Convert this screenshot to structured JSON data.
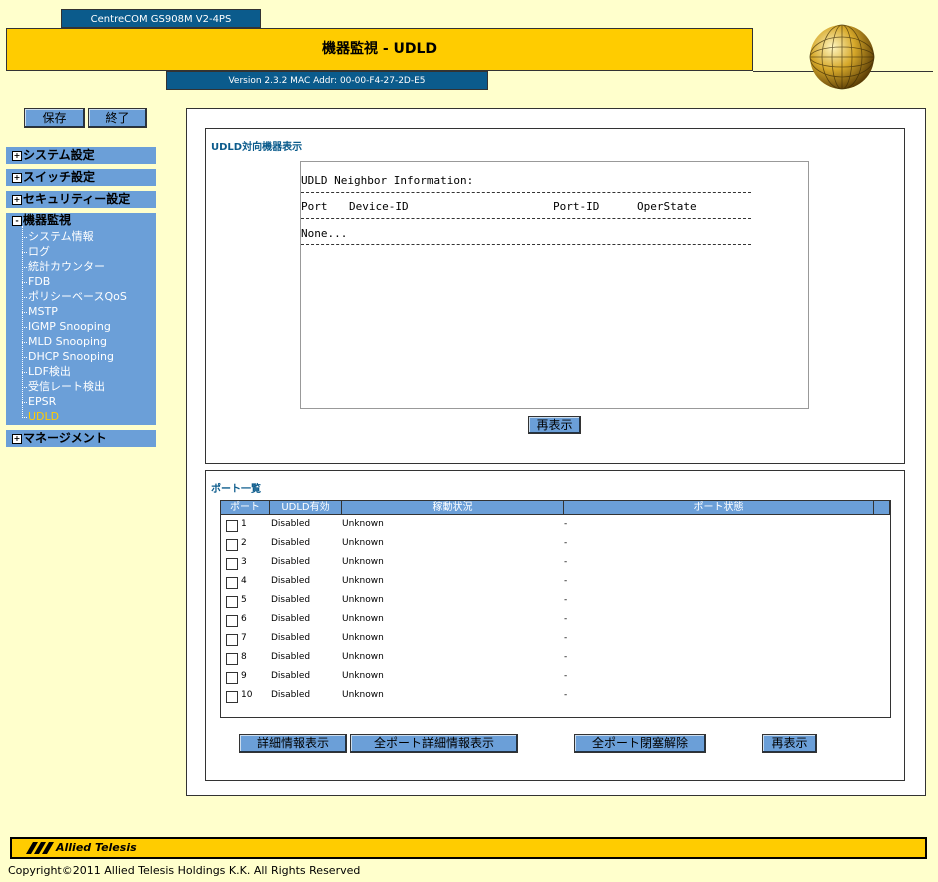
{
  "header": {
    "model": "CentreCOM GS908M V2-4PS",
    "title": "機器監視 - UDLD",
    "version": "Version 2.3.2 MAC Addr: 00-00-F4-27-2D-E5"
  },
  "toolbar": {
    "save_label": "保存",
    "exit_label": "終了"
  },
  "sidebar": {
    "sections": [
      {
        "label": "システム設定",
        "toggle": "+"
      },
      {
        "label": "スイッチ設定",
        "toggle": "+"
      },
      {
        "label": "セキュリティー設定",
        "toggle": "+"
      },
      {
        "label": "機器監視",
        "toggle": "-"
      },
      {
        "label": "マネージメント",
        "toggle": "+"
      }
    ],
    "monitor_items": [
      "システム情報",
      "ログ",
      "統計カウンター",
      "FDB",
      "ポリシーベースQoS",
      "MSTP",
      "IGMP Snooping",
      "MLD Snooping",
      "DHCP Snooping",
      "LDF検出",
      "受信レート検出",
      "EPSR",
      "UDLD"
    ],
    "active_item": "UDLD",
    "active_color": "#ffcc00"
  },
  "udld_panel": {
    "title": "UDLD対向機器表示",
    "info_heading": "UDLD Neighbor Information:",
    "col_port": "Port",
    "col_device": "Device-ID",
    "col_port_id": "Port-ID",
    "col_oper": "OperState",
    "none_text": "None...",
    "refresh_label": "再表示"
  },
  "ports_panel": {
    "title": "ポート一覧",
    "headers": [
      "ポート",
      "UDLD有効",
      "稼動状況",
      "ポート状態"
    ],
    "rows": [
      {
        "port": "1",
        "udld": "Disabled",
        "status": "Unknown",
        "state": "-"
      },
      {
        "port": "2",
        "udld": "Disabled",
        "status": "Unknown",
        "state": "-"
      },
      {
        "port": "3",
        "udld": "Disabled",
        "status": "Unknown",
        "state": "-"
      },
      {
        "port": "4",
        "udld": "Disabled",
        "status": "Unknown",
        "state": "-"
      },
      {
        "port": "5",
        "udld": "Disabled",
        "status": "Unknown",
        "state": "-"
      },
      {
        "port": "6",
        "udld": "Disabled",
        "status": "Unknown",
        "state": "-"
      },
      {
        "port": "7",
        "udld": "Disabled",
        "status": "Unknown",
        "state": "-"
      },
      {
        "port": "8",
        "udld": "Disabled",
        "status": "Unknown",
        "state": "-"
      },
      {
        "port": "9",
        "udld": "Disabled",
        "status": "Unknown",
        "state": "-"
      },
      {
        "port": "10",
        "udld": "Disabled",
        "status": "Unknown",
        "state": "-"
      }
    ],
    "buttons": {
      "detail": "詳細情報表示",
      "all_detail": "全ポート詳細情報表示",
      "unblock_all": "全ポート閉塞解除",
      "refresh": "再表示"
    }
  },
  "footer": {
    "brand": "Allied Telesis",
    "copyright": "Copyright©2011 Allied Telesis Holdings K.K. All Rights Reserved"
  }
}
